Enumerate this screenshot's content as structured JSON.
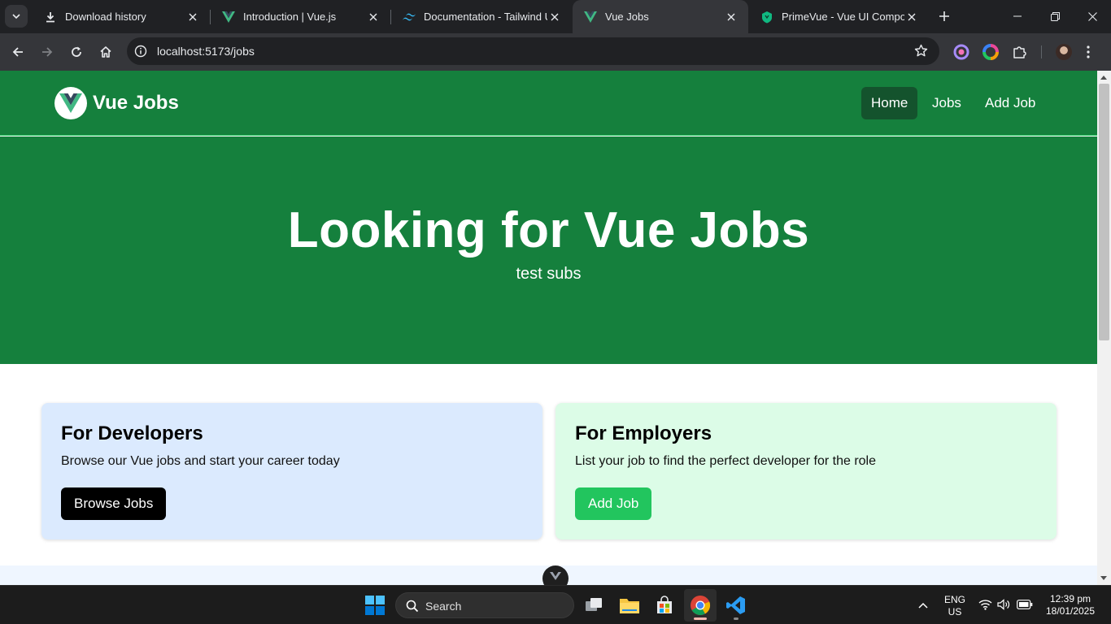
{
  "browser": {
    "tabs": [
      {
        "title": "Download history",
        "icon": "download-icon",
        "active": false
      },
      {
        "title": "Introduction | Vue.js",
        "icon": "vue-logo-icon",
        "active": false
      },
      {
        "title": "Documentation - Tailwind UI",
        "icon": "tailwind-logo-icon",
        "active": false
      },
      {
        "title": "Vue Jobs",
        "icon": "vue-logo-icon",
        "active": true
      },
      {
        "title": "PrimeVue - Vue UI Compone",
        "icon": "primevue-logo-icon",
        "active": false
      }
    ],
    "url": "localhost:5173/jobs"
  },
  "navbar": {
    "brand": "Vue Jobs",
    "links": [
      {
        "label": "Home",
        "active": true
      },
      {
        "label": "Jobs",
        "active": false
      },
      {
        "label": "Add Job",
        "active": false
      }
    ]
  },
  "hero": {
    "title": "Looking for Vue Jobs",
    "subtitle": "test subs"
  },
  "cards": {
    "developers": {
      "title": "For Developers",
      "text": "Browse our Vue jobs and start your career today",
      "button": "Browse Jobs"
    },
    "employers": {
      "title": "For Employers",
      "text": "List your job to find the perfect developer for the role",
      "button": "Add Job"
    }
  },
  "taskbar": {
    "search_label": "Search",
    "language": "ENG",
    "region": "US",
    "time": "12:39 pm",
    "date": "18/01/2025"
  },
  "colors": {
    "brand_green": "#15803d",
    "active_nav": "#14532d",
    "developers_card": "#dbeafe",
    "employers_card": "#dcfce7",
    "add_job_button": "#22c55e"
  }
}
